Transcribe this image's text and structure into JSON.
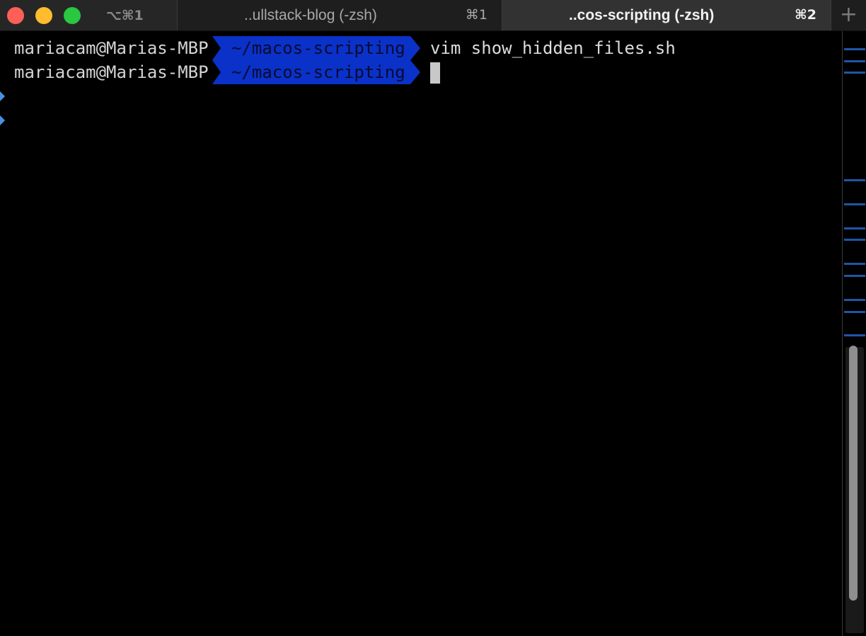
{
  "titlebar": {
    "window_shortcut": "⌥⌘1",
    "tabs": [
      {
        "title": "..ullstack-blog (-zsh)",
        "shortcut": "⌘1",
        "active": false
      },
      {
        "title": "..cos-scripting (-zsh)",
        "shortcut": "⌘2",
        "active": true
      }
    ],
    "new_tab_symbol": "+"
  },
  "terminal": {
    "lines": [
      {
        "host": "mariacam@Marias-MBP",
        "cwd": "~/macos-scripting",
        "command": "vim show_hidden_files.sh"
      },
      {
        "host": "mariacam@Marias-MBP",
        "cwd": "~/macos-scripting",
        "command": ""
      }
    ]
  },
  "colors": {
    "background": "#000000",
    "prompt_arrow": "#4a90e2",
    "cwd_segment": "#0a32c8",
    "cwd_text": "#0a0a30",
    "text": "#d4d4d4",
    "scroll_mark": "#1f55a8",
    "close": "#fe5f57",
    "minimize": "#febc2e",
    "maximize": "#28c840"
  },
  "icons": {
    "prompt": "chevron-right-icon",
    "new_tab": "plus-icon"
  }
}
